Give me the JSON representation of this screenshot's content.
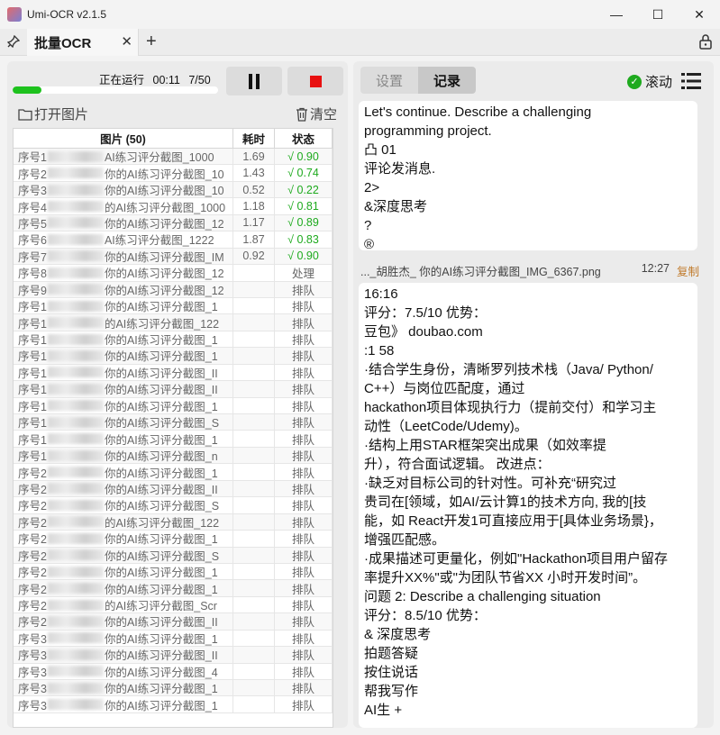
{
  "window": {
    "title": "Umi-OCR v2.1.5",
    "controls": [
      "—",
      "☐",
      "✕"
    ]
  },
  "tab": {
    "label": "批量OCR",
    "close": "✕",
    "add": "+"
  },
  "task": {
    "status": "正在运行",
    "elapsed": "00:11",
    "counter": "7/50",
    "progress": 0.14
  },
  "actions": {
    "open": "打开图片",
    "clear": "清空"
  },
  "table": {
    "headers": [
      "图片 (50)",
      "耗时",
      "状态"
    ],
    "rows": [
      {
        "name": "序号1",
        "file": "AI练习评分截图_1000",
        "time": "1.69",
        "status": "√ 0.90",
        "ok": true
      },
      {
        "name": "序号2",
        "file": "你的AI练习评分截图_10",
        "time": "1.43",
        "status": "√ 0.74",
        "ok": true
      },
      {
        "name": "序号3",
        "file": "你的AI练习评分截图_10",
        "time": "0.52",
        "status": "√ 0.22",
        "ok": true
      },
      {
        "name": "序号4",
        "file": "的AI练习评分截图_1000",
        "time": "1.18",
        "status": "√ 0.81",
        "ok": true
      },
      {
        "name": "序号5",
        "file": "你的AI练习评分截图_12",
        "time": "1.17",
        "status": "√ 0.89",
        "ok": true
      },
      {
        "name": "序号6",
        "file": "AI练习评分截图_1222",
        "time": "1.87",
        "status": "√ 0.83",
        "ok": true
      },
      {
        "name": "序号7",
        "file": "你的AI练习评分截图_IM",
        "time": "0.92",
        "status": "√ 0.90",
        "ok": true
      },
      {
        "name": "序号8",
        "file": "你的AI练习评分截图_12",
        "time": "",
        "status": "处理",
        "ok": false
      },
      {
        "name": "序号9",
        "file": "你的AI练习评分截图_12",
        "time": "",
        "status": "排队",
        "ok": false
      },
      {
        "name": "序号1",
        "file": "你的AI练习评分截图_1",
        "time": "",
        "status": "排队",
        "ok": false
      },
      {
        "name": "序号1",
        "file": "的AI练习评分截图_122",
        "time": "",
        "status": "排队",
        "ok": false
      },
      {
        "name": "序号1",
        "file": "你的AI练习评分截图_1",
        "time": "",
        "status": "排队",
        "ok": false
      },
      {
        "name": "序号1",
        "file": "你的AI练习评分截图_1",
        "time": "",
        "status": "排队",
        "ok": false
      },
      {
        "name": "序号1",
        "file": "你的AI练习评分截图_II",
        "time": "",
        "status": "排队",
        "ok": false
      },
      {
        "name": "序号1",
        "file": "你的AI练习评分截图_II",
        "time": "",
        "status": "排队",
        "ok": false
      },
      {
        "name": "序号1",
        "file": "你的AI练习评分截图_1",
        "time": "",
        "status": "排队",
        "ok": false
      },
      {
        "name": "序号1",
        "file": "你的AI练习评分截图_S",
        "time": "",
        "status": "排队",
        "ok": false
      },
      {
        "name": "序号1",
        "file": "你的AI练习评分截图_1",
        "time": "",
        "status": "排队",
        "ok": false
      },
      {
        "name": "序号1",
        "file": "你的AI练习评分截图_n",
        "time": "",
        "status": "排队",
        "ok": false
      },
      {
        "name": "序号2",
        "file": "你的AI练习评分截图_1",
        "time": "",
        "status": "排队",
        "ok": false
      },
      {
        "name": "序号2",
        "file": "你的AI练习评分截图_II",
        "time": "",
        "status": "排队",
        "ok": false
      },
      {
        "name": "序号2",
        "file": "你的AI练习评分截图_S",
        "time": "",
        "status": "排队",
        "ok": false
      },
      {
        "name": "序号2",
        "file": "的AI练习评分截图_122",
        "time": "",
        "status": "排队",
        "ok": false
      },
      {
        "name": "序号2",
        "file": "你的AI练习评分截图_1",
        "time": "",
        "status": "排队",
        "ok": false
      },
      {
        "name": "序号2",
        "file": "你的AI练习评分截图_S",
        "time": "",
        "status": "排队",
        "ok": false
      },
      {
        "name": "序号2",
        "file": "你的AI练习评分截图_1",
        "time": "",
        "status": "排队",
        "ok": false
      },
      {
        "name": "序号2",
        "file": "你的AI练习评分截图_1",
        "time": "",
        "status": "排队",
        "ok": false
      },
      {
        "name": "序号2",
        "file": "的AI练习评分截图_Scr",
        "time": "",
        "status": "排队",
        "ok": false
      },
      {
        "name": "序号2",
        "file": "你的AI练习评分截图_II",
        "time": "",
        "status": "排队",
        "ok": false
      },
      {
        "name": "序号3",
        "file": "你的AI练习评分截图_1",
        "time": "",
        "status": "排队",
        "ok": false
      },
      {
        "name": "序号3",
        "file": "你的AI练习评分截图_II",
        "time": "",
        "status": "排队",
        "ok": false
      },
      {
        "name": "序号3",
        "file": "你的AI练习评分截图_4",
        "time": "",
        "status": "排队",
        "ok": false
      },
      {
        "name": "序号3",
        "file": "你的AI练习评分截图_1",
        "time": "",
        "status": "排队",
        "ok": false
      },
      {
        "name": "序号3",
        "file": "你的AI练习评分截图_1",
        "time": "",
        "status": "排队",
        "ok": false
      }
    ]
  },
  "right": {
    "tabs": [
      "设置",
      "记录"
    ],
    "scroll_label": "滚动",
    "card1_lines": [
      "Let's continue. Describe a challenging",
      "programming project.",
      "凸 01",
      "评论发消息.",
      "2>",
      "&深度思考",
      "?",
      "®"
    ],
    "meta": {
      "filename": "..._胡胜杰_ 你的AI练习评分截图_IMG_6367.png",
      "time": "12:27",
      "copy": "复制"
    },
    "card2_lines": [
      "16:16",
      "评分：7.5/10 优势：",
      "豆包》 doubao.com",
      ":1  58",
      "·结合学生身份，清晰罗列技术栈（Java/ Python/",
      "C++）与岗位匹配度，通过",
      "hackathon项目体现执行力（提前交付）和学习主",
      "动性（LeetCode/Udemy)。",
      "·结构上用STAR框架突出成果（如效率提",
      "升），符合面试逻辑。    改进点：",
      "·缺乏对目标公司的针对性。可补充“研究过",
      "贵司在[领域，如AI/云计算1的技术方向, 我的[技",
      "能，如 React开发1可直接应用于[具体业务场景}，",
      "增强匹配感。",
      "·成果描述可更量化，例如\"Hackathon项目用户留存",
      "率提升XX%\"或\"为团队节省XX 小时开发时间”。",
      "问题 2: Describe a challenging situation",
      "评分：8.5/10 优势：",
      "& 深度思考",
      " 拍题答疑",
      "按住说话",
      "帮我写作",
      "AI生 +"
    ]
  },
  "colors": {
    "accent_green": "#1eaa1e",
    "stop_red": "#e81010",
    "copy_orange": "#c07a2a"
  }
}
